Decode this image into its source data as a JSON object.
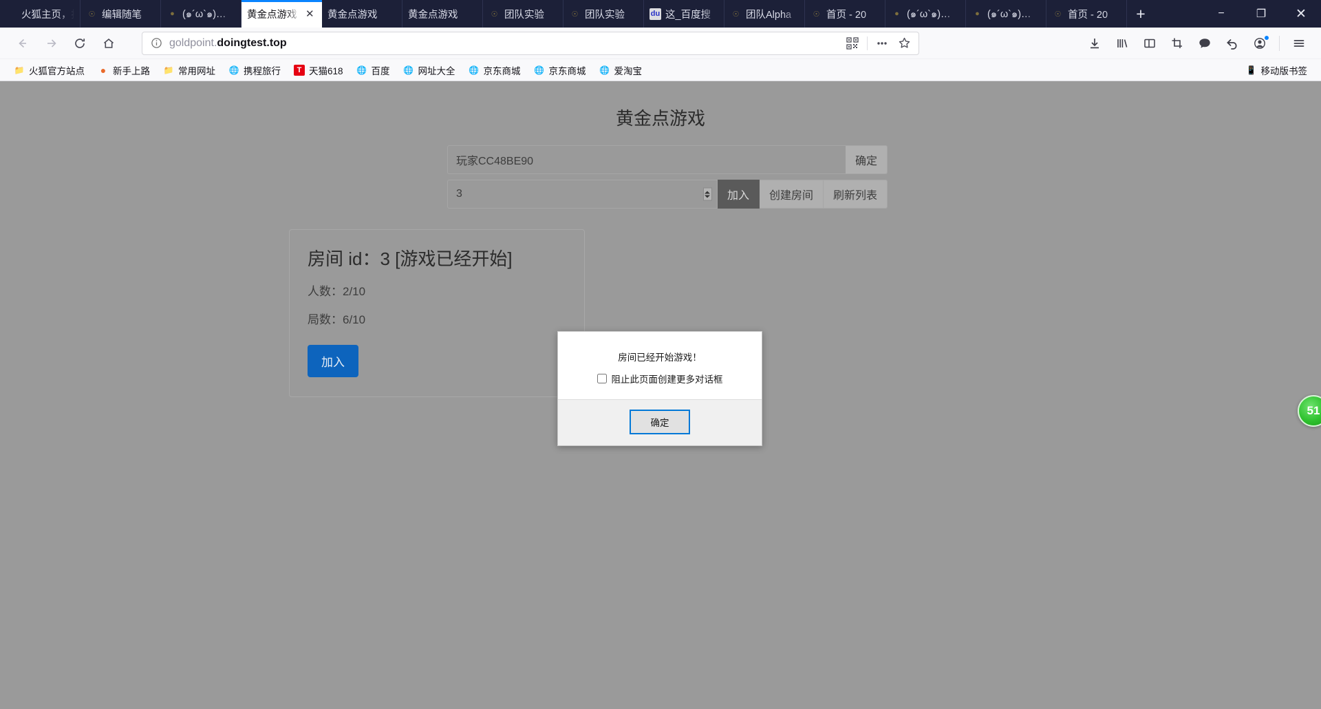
{
  "browser": {
    "tabs": [
      {
        "label": "火狐主页，推",
        "favicon": "none",
        "active": false,
        "closable": false
      },
      {
        "label": "编辑随笔",
        "favicon": "default-page-icon",
        "active": false,
        "closable": false
      },
      {
        "label": "(๑´ω`๑)…",
        "favicon": "dark-site-icon",
        "active": false,
        "closable": false
      },
      {
        "label": "黄金点游戏",
        "favicon": "none",
        "active": true,
        "closable": true
      },
      {
        "label": "黄金点游戏",
        "favicon": "none",
        "active": false,
        "closable": false
      },
      {
        "label": "黄金点游戏",
        "favicon": "none",
        "active": false,
        "closable": false
      },
      {
        "label": "团队实验",
        "favicon": "default-page-icon",
        "active": false,
        "closable": false
      },
      {
        "label": "团队实验",
        "favicon": "default-page-icon",
        "active": false,
        "closable": false
      },
      {
        "label": "这_百度搜",
        "favicon": "baidu-icon",
        "active": false,
        "closable": false
      },
      {
        "label": "团队Alpha",
        "favicon": "default-page-icon",
        "active": false,
        "closable": false
      },
      {
        "label": "首页 - 20",
        "favicon": "default-page-icon",
        "active": false,
        "closable": false
      },
      {
        "label": "(๑´ω`๑)…",
        "favicon": "dark-site-icon",
        "active": false,
        "closable": false
      },
      {
        "label": "(๑´ω`๑)…",
        "favicon": "dark-site-icon",
        "active": false,
        "closable": false
      },
      {
        "label": "首页 - 20",
        "favicon": "default-page-icon",
        "active": false,
        "closable": false
      }
    ],
    "new_tab_label": "+",
    "window_controls": {
      "minimize": "−",
      "maximize": "❐",
      "close": "✕"
    },
    "nav": {
      "back": "back-arrow",
      "forward": "forward-arrow",
      "reload": "reload",
      "home": "home"
    },
    "url": {
      "prefix": "goldpoint.",
      "domain": "doingtest.top",
      "full": "goldpoint.doingtest.top",
      "identity_icon": "info-circle-icon"
    },
    "url_actions": [
      "qr-code-icon",
      "page-actions-icon",
      "bookmark-star-icon"
    ],
    "toolbar_icons": [
      "download-icon",
      "library-icon",
      "sidebar-icon",
      "screenshot-icon",
      "chat-icon",
      "undo-icon",
      "account-icon",
      "menu-icon"
    ],
    "bookmarks": [
      {
        "label": "火狐官方站点",
        "icon": "folder-icon"
      },
      {
        "label": "新手上路",
        "icon": "firefox-icon"
      },
      {
        "label": "常用网址",
        "icon": "folder-icon"
      },
      {
        "label": "携程旅行",
        "icon": "globe-icon"
      },
      {
        "label": "天猫618",
        "icon": "tmall-icon"
      },
      {
        "label": "百度",
        "icon": "globe-icon"
      },
      {
        "label": "网址大全",
        "icon": "globe-icon"
      },
      {
        "label": "京东商城",
        "icon": "globe-icon"
      },
      {
        "label": "京东商城",
        "icon": "globe-icon"
      },
      {
        "label": "爱淘宝",
        "icon": "globe-icon"
      }
    ],
    "mobile_bookmarks": {
      "label": "移动版书签",
      "icon": "mobile-icon"
    }
  },
  "page": {
    "title": "黄金点游戏",
    "name_input": {
      "value": "玩家CC48BE90",
      "placeholder": "玩家CC48BE90"
    },
    "confirm_name_button": "确定",
    "room_id_input": {
      "value": "3",
      "placeholder": "3"
    },
    "buttons": {
      "join": "加入",
      "create_room": "创建房间",
      "refresh_list": "刷新列表"
    },
    "room_card": {
      "title": "房间 id：3 [游戏已经开始]",
      "players_line": "人数：2/10",
      "rounds_line": "局数：6/10",
      "join_button": "加入"
    }
  },
  "dialog": {
    "message": "房间已经开始游戏！",
    "suppress_checkbox_label": "阻止此页面创建更多对话框",
    "suppress_checked": false,
    "ok_button": "确定"
  },
  "widget": {
    "score_badge": "51"
  },
  "colors": {
    "tabstrip_bg": "#1c2038",
    "accent_blue": "#0a84ff",
    "page_dim": "#9a9a9a",
    "join_button": "#0d64bd",
    "dialog_focus_border": "#0078d7",
    "score_green": "#2fc22f"
  }
}
